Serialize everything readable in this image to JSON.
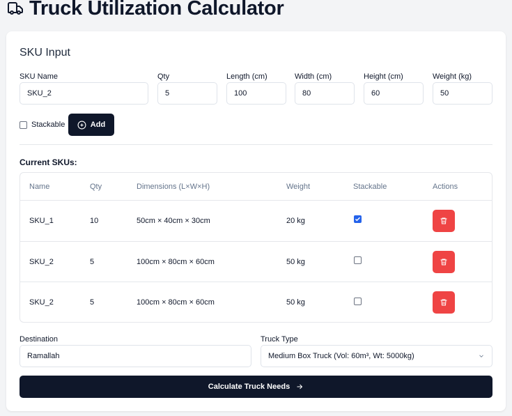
{
  "page_title": "Truck Utilization Calculator",
  "sku_input": {
    "section_title": "SKU Input",
    "fields": {
      "sku_name": {
        "label": "SKU Name",
        "value": "SKU_2"
      },
      "qty": {
        "label": "Qty",
        "value": "5"
      },
      "length": {
        "label": "Length (cm)",
        "value": "100"
      },
      "width": {
        "label": "Width (cm)",
        "value": "80"
      },
      "height": {
        "label": "Height (cm)",
        "value": "60"
      },
      "weight": {
        "label": "Weight (kg)",
        "value": "50"
      }
    },
    "stackable_label": "Stackable",
    "stackable_checked": false,
    "add_button_label": "Add"
  },
  "current_skus": {
    "label": "Current SKUs:",
    "columns": [
      "Name",
      "Qty",
      "Dimensions (L×W×H)",
      "Weight",
      "Stackable",
      "Actions"
    ],
    "rows": [
      {
        "name": "SKU_1",
        "qty": "10",
        "dimensions": "50cm × 40cm × 30cm",
        "weight": "20 kg",
        "stackable": true
      },
      {
        "name": "SKU_2",
        "qty": "5",
        "dimensions": "100cm × 80cm × 60cm",
        "weight": "50 kg",
        "stackable": false
      },
      {
        "name": "SKU_2",
        "qty": "5",
        "dimensions": "100cm × 80cm × 60cm",
        "weight": "50 kg",
        "stackable": false
      }
    ]
  },
  "destination": {
    "label": "Destination",
    "value": "Ramallah"
  },
  "truck_type": {
    "label": "Truck Type",
    "selected": "Medium Box Truck (Vol: 60m³, Wt: 5000kg)"
  },
  "calculate_button_label": "Calculate Truck Needs",
  "colors": {
    "primary": "#0f172a",
    "danger": "#ef4444",
    "accent": "#2563eb"
  }
}
